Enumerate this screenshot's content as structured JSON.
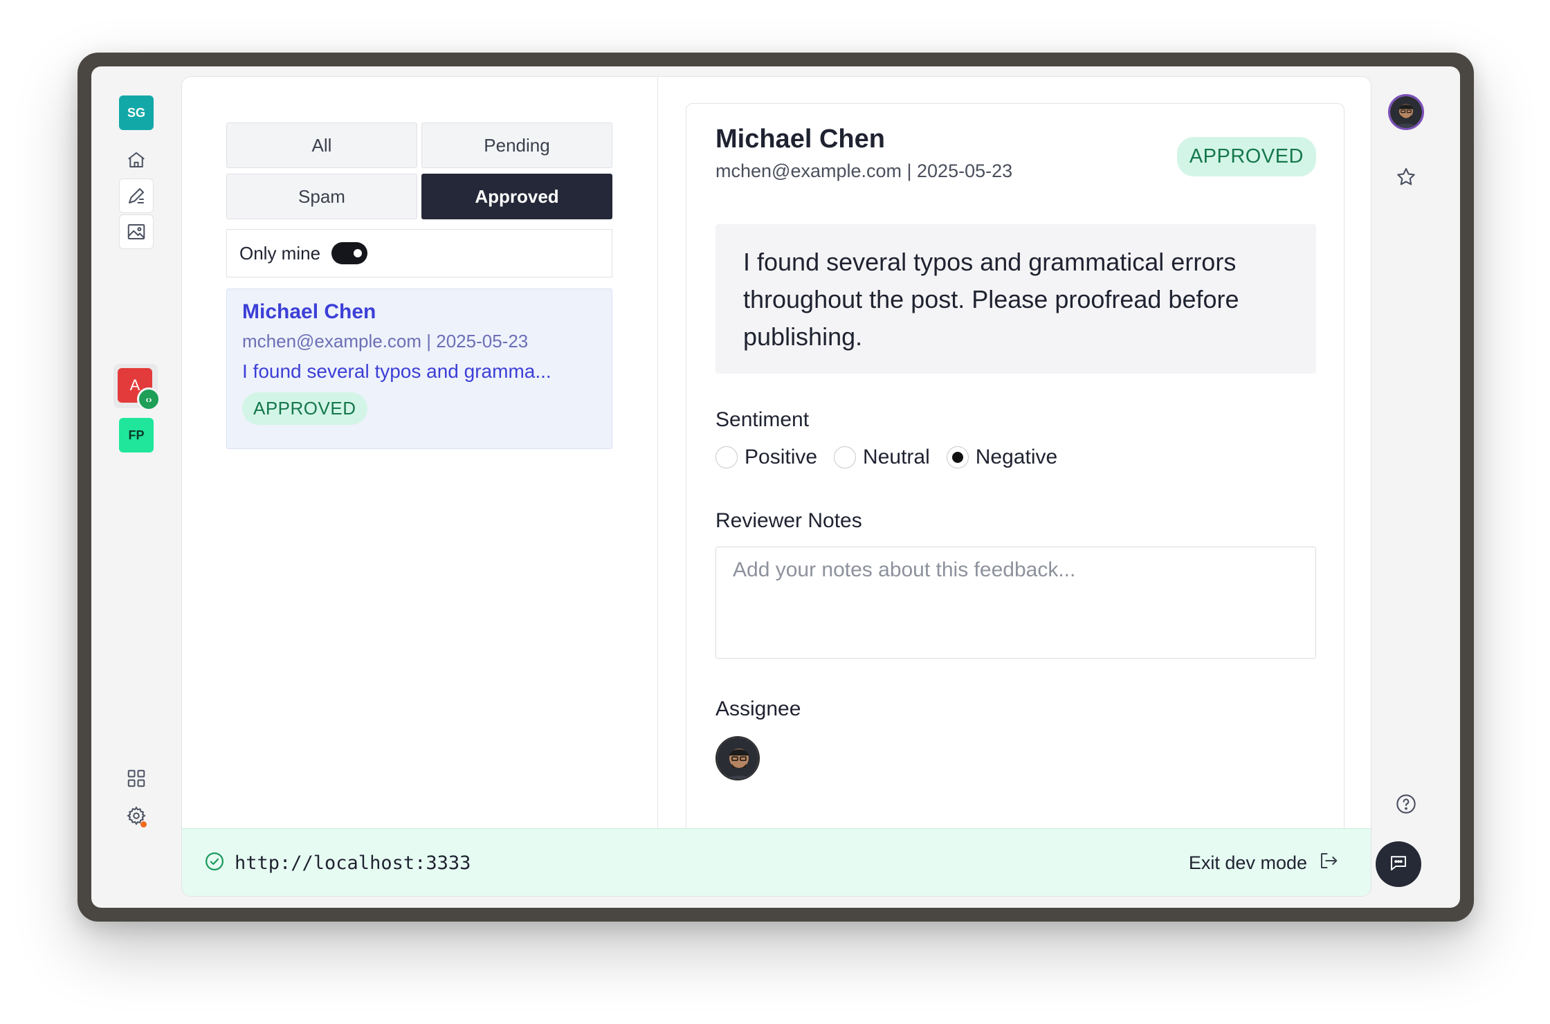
{
  "sidebar": {
    "workspace_badge": "SG",
    "app_badge": "A",
    "project_badge": "FP",
    "icons": [
      "home-icon",
      "edit-icon",
      "image-icon",
      "grid-icon",
      "gear-icon"
    ]
  },
  "filters": {
    "tabs": [
      "All",
      "Pending",
      "Spam",
      "Approved"
    ],
    "active": "Approved",
    "only_mine_label": "Only mine",
    "only_mine_on": true
  },
  "list": {
    "items": [
      {
        "name": "Michael Chen",
        "meta": "mchen@example.com | 2025-05-23",
        "excerpt": "I found several typos and gramma...",
        "status": "APPROVED"
      }
    ]
  },
  "detail": {
    "name": "Michael Chen",
    "meta": "mchen@example.com | 2025-05-23",
    "status": "APPROVED",
    "message": "I found several typos and grammatical errors throughout the post. Please proofread before publishing.",
    "sentiment_label": "Sentiment",
    "sentiment_options": [
      "Positive",
      "Neutral",
      "Negative"
    ],
    "sentiment_selected": "Negative",
    "notes_label": "Reviewer Notes",
    "notes_placeholder": "Add your notes about this feedback...",
    "assignee_label": "Assignee"
  },
  "devbar": {
    "url": "http://localhost:3333",
    "exit_label": "Exit dev mode"
  },
  "colors": {
    "accent": "#3c3fd6",
    "approved_bg": "#d3f5e7",
    "approved_text": "#15774c",
    "active_tab": "#242838",
    "devbar_bg": "#e6fbf2"
  }
}
